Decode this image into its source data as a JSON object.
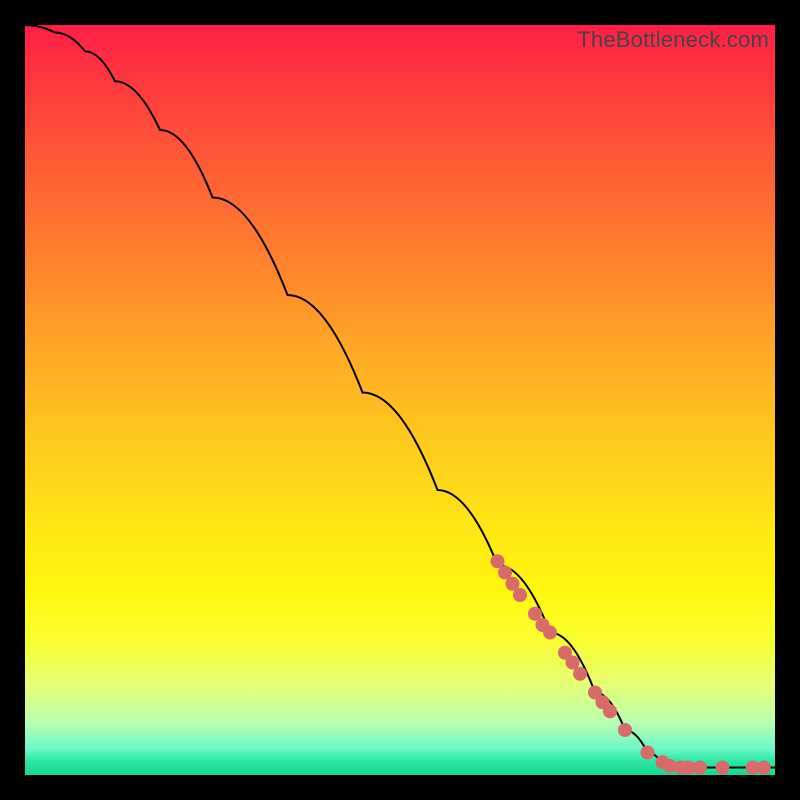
{
  "watermark": "TheBottleneck.com",
  "chart_data": {
    "type": "line",
    "title": "",
    "xlabel": "",
    "ylabel": "",
    "xlim": [
      0,
      100
    ],
    "ylim": [
      0,
      100
    ],
    "grid": false,
    "legend": false,
    "series": [
      {
        "name": "curve",
        "stroke": "#000000",
        "stroke_width": 2,
        "points": [
          {
            "x": 0,
            "y": 100
          },
          {
            "x": 4,
            "y": 99
          },
          {
            "x": 8,
            "y": 96.5
          },
          {
            "x": 12,
            "y": 92.5
          },
          {
            "x": 18,
            "y": 86
          },
          {
            "x": 25,
            "y": 77
          },
          {
            "x": 35,
            "y": 64
          },
          {
            "x": 45,
            "y": 51
          },
          {
            "x": 55,
            "y": 38
          },
          {
            "x": 63,
            "y": 28
          },
          {
            "x": 70,
            "y": 19
          },
          {
            "x": 76,
            "y": 11
          },
          {
            "x": 80,
            "y": 6
          },
          {
            "x": 83,
            "y": 3
          },
          {
            "x": 85,
            "y": 1.5
          },
          {
            "x": 87,
            "y": 1
          },
          {
            "x": 92,
            "y": 1
          },
          {
            "x": 100,
            "y": 1
          }
        ]
      }
    ],
    "scatter": {
      "name": "highlighted-points",
      "fill": "#d86a6a",
      "radius": 7,
      "points": [
        {
          "x": 63,
          "y": 28.5
        },
        {
          "x": 64,
          "y": 27
        },
        {
          "x": 65,
          "y": 25.5
        },
        {
          "x": 66,
          "y": 24
        },
        {
          "x": 68,
          "y": 21.5
        },
        {
          "x": 69,
          "y": 20
        },
        {
          "x": 70,
          "y": 19
        },
        {
          "x": 72,
          "y": 16.3
        },
        {
          "x": 73,
          "y": 15
        },
        {
          "x": 74,
          "y": 13.5
        },
        {
          "x": 76,
          "y": 11
        },
        {
          "x": 77,
          "y": 9.7
        },
        {
          "x": 78,
          "y": 8.5
        },
        {
          "x": 80,
          "y": 6
        },
        {
          "x": 83,
          "y": 3
        },
        {
          "x": 85,
          "y": 1.7
        },
        {
          "x": 86,
          "y": 1.2
        },
        {
          "x": 87.5,
          "y": 1
        },
        {
          "x": 88.5,
          "y": 1
        },
        {
          "x": 90,
          "y": 1
        },
        {
          "x": 93,
          "y": 1
        },
        {
          "x": 97,
          "y": 1
        },
        {
          "x": 98.5,
          "y": 1
        }
      ]
    }
  }
}
